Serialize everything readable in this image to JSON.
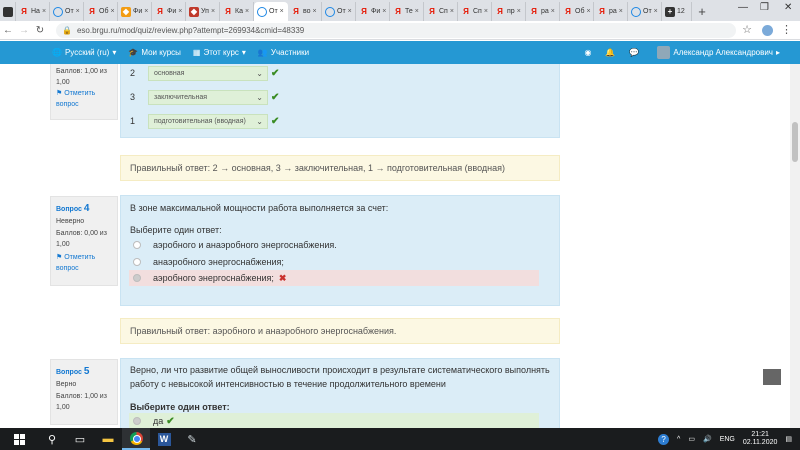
{
  "browser": {
    "tabs": [
      {
        "label": "",
        "favicon": "film-icon",
        "kind": "fav-film"
      },
      {
        "label": "На",
        "favicon": "yandex-icon",
        "kind": "fav-ya"
      },
      {
        "label": "От",
        "favicon": "moodle-icon",
        "kind": "fav-moodle"
      },
      {
        "label": "Об",
        "favicon": "yandex-icon",
        "kind": "fav-ya"
      },
      {
        "label": "Фи",
        "favicon": "orange-icon",
        "kind": "fav-orange"
      },
      {
        "label": "Фи",
        "favicon": "yandex-icon",
        "kind": "fav-ya"
      },
      {
        "label": "Уп",
        "favicon": "red-icon",
        "kind": "fav-red"
      },
      {
        "label": "Ка",
        "favicon": "yandex-icon",
        "kind": "fav-ya"
      },
      {
        "label": "От",
        "favicon": "moodle-icon",
        "kind": "fav-moodle",
        "active": true
      },
      {
        "label": "во",
        "favicon": "yandex-icon",
        "kind": "fav-ya"
      },
      {
        "label": "От",
        "favicon": "moodle-icon",
        "kind": "fav-moodle"
      },
      {
        "label": "Фи",
        "favicon": "yandex-icon",
        "kind": "fav-ya"
      },
      {
        "label": "Те",
        "favicon": "yandex-icon",
        "kind": "fav-ya"
      },
      {
        "label": "Сп",
        "favicon": "yandex-icon",
        "kind": "fav-ya"
      },
      {
        "label": "Сп",
        "favicon": "yandex-icon",
        "kind": "fav-ya"
      },
      {
        "label": "пр",
        "favicon": "yandex-icon",
        "kind": "fav-ya"
      },
      {
        "label": "ра",
        "favicon": "yandex-icon",
        "kind": "fav-ya"
      },
      {
        "label": "Об",
        "favicon": "yandex-icon",
        "kind": "fav-ya"
      },
      {
        "label": "ра",
        "favicon": "yandex-icon",
        "kind": "fav-ya"
      },
      {
        "label": "От",
        "favicon": "moodle-icon",
        "kind": "fav-moodle"
      },
      {
        "label": "12",
        "favicon": "plus-icon",
        "kind": "fav-plus"
      }
    ],
    "url": "eso.brgu.ru/mod/quiz/review.php?attempt=269934&cmid=48339"
  },
  "navbar": {
    "language": "Русский (ru)",
    "my_courses": "Мои курсы",
    "this_course": "Этот курс",
    "participants": "Участники",
    "user": "Александр Александрович"
  },
  "question3": {
    "grade": "Баллов: 1,00 из 1,00",
    "flag": "Отметить вопрос",
    "rows": [
      {
        "num": "2",
        "value": "основная"
      },
      {
        "num": "3",
        "value": "заключительная"
      },
      {
        "num": "1",
        "value": "подготовительная (вводная)"
      }
    ],
    "feedback": "Правильный ответ: 2 → основная, 3 → заключительная, 1 → подготовительная (вводная)"
  },
  "question4": {
    "title_prefix": "Вопрос",
    "number": "4",
    "state": "Неверно",
    "grade": "Баллов: 0,00 из 1,00",
    "flag": "Отметить вопрос",
    "text": "В зоне максимальной мощности работа выполняется за счет:",
    "prompt": "Выберите один ответ:",
    "options": [
      "аэробного и анаэробного энергоснабжения.",
      "анаэробного энергоснабжения;",
      "аэробного энергоснабжения;"
    ],
    "feedback": "Правильный ответ: аэробного и анаэробного энергоснабжения."
  },
  "question5": {
    "title_prefix": "Вопрос",
    "number": "5",
    "state": "Верно",
    "grade": "Баллов: 1,00 из 1,00",
    "text_line1": "Верно, ли что развитие общей выносливости происходит в результате систематического выполнять",
    "text_line2": "работу с невысокой интенсивностью в течение продолжительного времени",
    "prompt": "Выберите один ответ:",
    "option_yes": "да"
  },
  "taskbar": {
    "lang": "ENG",
    "time": "21:21",
    "date": "02.11.2020"
  }
}
